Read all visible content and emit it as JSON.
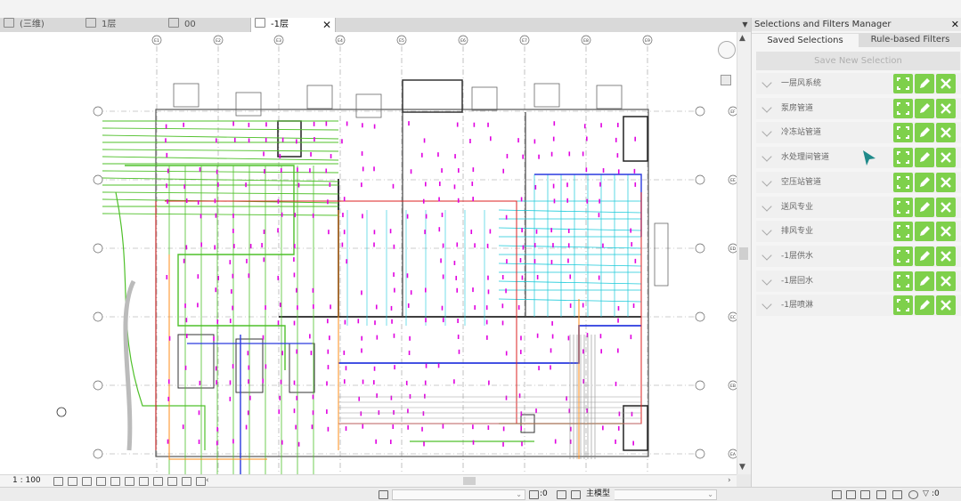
{
  "tabs": [
    {
      "label": "(三维)",
      "active": false,
      "icon": "3d-view-icon"
    },
    {
      "label": "1层",
      "active": false,
      "icon": "plan-view-icon"
    },
    {
      "label": "00",
      "active": false,
      "icon": "ceiling-view-icon"
    },
    {
      "label": "-1层",
      "active": true,
      "icon": "plan-view-icon",
      "close": "✕"
    }
  ],
  "grid": {
    "columns": [
      "E1",
      "E2",
      "E3",
      "E4",
      "E5",
      "E6",
      "E7",
      "E8",
      "E9"
    ],
    "rows": [
      "EF",
      "EE",
      "ED",
      "EC",
      "EB",
      "EA"
    ]
  },
  "view_control": {
    "scale": "1 : 100"
  },
  "status_bar": {
    "counter": ":0",
    "model": "主模型",
    "filter_count": ":0"
  },
  "panel": {
    "title": "Selections and Filters Manager",
    "close": "✕",
    "tabs": [
      "Saved Selections",
      "Rule-based Filters"
    ],
    "save_button": "Save New Selection",
    "selections": [
      "一层风系统",
      "泵房管道",
      "冷冻站管道",
      "水处理间管道",
      "空压站管道",
      "送风专业",
      "排风专业",
      "-1层供水",
      "-1层回水",
      "-1层喷淋"
    ]
  },
  "colors": {
    "accent_green": "#7ed04b",
    "magenta_pipes": "#e000e0",
    "green_ducts": "#4fc02a",
    "cyan_pipes": "#19c9d9",
    "blue_pipes": "#2a3adf",
    "red_lines": "#dd2222",
    "orange_lines": "#ff8c1a"
  }
}
